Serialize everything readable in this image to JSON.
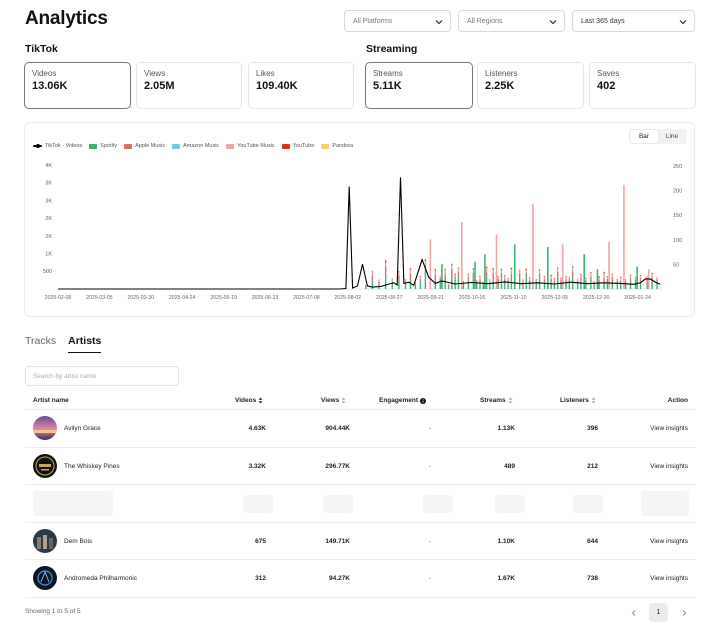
{
  "header": {
    "title": "Analytics"
  },
  "filters": {
    "platforms": "All Platforms",
    "regions": "All Regions",
    "period": "Last 365 days"
  },
  "tiktok": {
    "title": "TikTok",
    "stats": [
      {
        "label": "Videos",
        "value": "13.06K"
      },
      {
        "label": "Views",
        "value": "2.05M"
      },
      {
        "label": "Likes",
        "value": "109.40K"
      }
    ]
  },
  "streaming": {
    "title": "Streaming",
    "stats": [
      {
        "label": "Streams",
        "value": "5.11K"
      },
      {
        "label": "Listeners",
        "value": "2.25K"
      },
      {
        "label": "Saves",
        "value": "402"
      }
    ]
  },
  "chart_toggle": {
    "bar": "Bar",
    "line": "Line",
    "selected": "Bar"
  },
  "chart_data": {
    "type": "bar",
    "legend": [
      {
        "name": "TikTok - Videos",
        "color": "#000000",
        "kind": "line"
      },
      {
        "name": "Spotify",
        "color": "#3cb371",
        "kind": "bar"
      },
      {
        "name": "Apple Music",
        "color": "#e06b6b",
        "kind": "bar"
      },
      {
        "name": "Amazon Music",
        "color": "#76c7df",
        "kind": "bar"
      },
      {
        "name": "YouTube Music",
        "color": "#f2a3a3",
        "kind": "bar"
      },
      {
        "name": "YouTube",
        "color": "#d93025",
        "kind": "bar"
      },
      {
        "name": "Pandora",
        "color": "#f2d36b",
        "kind": "bar"
      }
    ],
    "left_axis_ticks": [
      "4K",
      "3K",
      "3K",
      "2K",
      "2K",
      "1K",
      "500"
    ],
    "right_axis_ticks": [
      "250",
      "200",
      "150",
      "100",
      "50"
    ],
    "x_ticks": [
      "2025-02-08",
      "2025-03-05",
      "2025-03-30",
      "2025-04-24",
      "2025-05-19",
      "2025-06-13",
      "2025-07-08",
      "2025-08-02",
      "2025-08-27",
      "2025-09-21",
      "2025-10-16",
      "2025-11-10",
      "2025-12-05",
      "2025-12-30",
      "2026-01-24"
    ],
    "ylim_left": [
      0,
      4000
    ],
    "ylim_right": [
      0,
      250
    ],
    "tiktok_videos": [
      [
        0,
        0
      ],
      [
        170,
        0
      ],
      [
        174,
        15
      ],
      [
        176,
        3300
      ],
      [
        178,
        30
      ],
      [
        181,
        100
      ],
      [
        184,
        800
      ],
      [
        187,
        100
      ],
      [
        190,
        60
      ],
      [
        195,
        80
      ],
      [
        200,
        160
      ],
      [
        203,
        200
      ],
      [
        205,
        130
      ],
      [
        207,
        3600
      ],
      [
        209,
        180
      ],
      [
        212,
        220
      ],
      [
        215,
        120
      ],
      [
        220,
        950
      ],
      [
        224,
        380
      ],
      [
        228,
        180
      ],
      [
        232,
        260
      ],
      [
        240,
        160
      ],
      [
        250,
        210
      ],
      [
        260,
        170
      ],
      [
        270,
        230
      ],
      [
        280,
        170
      ],
      [
        290,
        200
      ],
      [
        300,
        160
      ],
      [
        310,
        220
      ],
      [
        320,
        170
      ],
      [
        330,
        200
      ],
      [
        340,
        180
      ],
      [
        348,
        150
      ],
      [
        352,
        200
      ],
      [
        355,
        330
      ],
      [
        358,
        320
      ],
      [
        361,
        220
      ],
      [
        364,
        150
      ]
    ],
    "streams": [
      [
        186,
        10
      ],
      [
        190,
        40
      ],
      [
        194,
        20
      ],
      [
        198,
        60
      ],
      [
        202,
        25
      ],
      [
        206,
        35
      ],
      [
        210,
        20
      ],
      [
        213,
        45
      ],
      [
        216,
        15
      ],
      [
        219,
        30
      ],
      [
        222,
        55
      ],
      [
        225,
        20
      ],
      [
        228,
        40
      ],
      [
        231,
        25
      ],
      [
        234,
        45
      ],
      [
        236,
        15
      ],
      [
        238,
        50
      ],
      [
        240,
        30
      ],
      [
        242,
        40
      ],
      [
        245,
        20
      ],
      [
        248,
        35
      ],
      [
        251,
        50
      ],
      [
        253,
        20
      ],
      [
        255,
        30
      ],
      [
        257,
        15
      ],
      [
        259,
        60
      ],
      [
        261,
        20
      ],
      [
        263,
        45
      ],
      [
        266,
        25
      ],
      [
        268,
        35
      ],
      [
        270,
        30
      ],
      [
        272,
        20
      ],
      [
        274,
        50
      ],
      [
        276,
        25
      ],
      [
        279,
        35
      ],
      [
        281,
        20
      ],
      [
        283,
        40
      ],
      [
        285,
        30
      ],
      [
        287,
        25
      ],
      [
        289,
        20
      ],
      [
        291,
        45
      ],
      [
        294,
        30
      ],
      [
        296,
        20
      ],
      [
        298,
        35
      ],
      [
        300,
        25
      ],
      [
        302,
        40
      ],
      [
        304,
        20
      ],
      [
        307,
        30
      ],
      [
        309,
        25
      ],
      [
        311,
        40
      ],
      [
        314,
        20
      ],
      [
        316,
        30
      ],
      [
        319,
        25
      ],
      [
        322,
        35
      ],
      [
        324,
        20
      ],
      [
        327,
        30
      ],
      [
        330,
        40
      ],
      [
        332,
        25
      ],
      [
        335,
        30
      ],
      [
        338,
        20
      ],
      [
        340,
        30
      ],
      [
        343,
        25
      ],
      [
        346,
        35
      ],
      [
        349,
        25
      ],
      [
        352,
        30
      ],
      [
        356,
        25
      ],
      [
        359,
        30
      ],
      [
        362,
        25
      ]
    ],
    "streams_spikes": [
      [
        225,
        100
      ],
      [
        232,
        50
      ],
      [
        244,
        135
      ],
      [
        252,
        55
      ],
      [
        258,
        70
      ],
      [
        265,
        110
      ],
      [
        276,
        90
      ],
      [
        287,
        172
      ],
      [
        296,
        85
      ],
      [
        305,
        90
      ],
      [
        318,
        70
      ],
      [
        326,
        40
      ],
      [
        333,
        95
      ],
      [
        342,
        210
      ],
      [
        350,
        45
      ],
      [
        357,
        40
      ]
    ]
  },
  "tabs": {
    "tracks": "Tracks",
    "artists": "Artists"
  },
  "search": {
    "placeholder": "Search by artist name"
  },
  "table": {
    "headers": {
      "artist": "Artist name",
      "videos": "Videos",
      "views": "Views",
      "engagement": "Engagement",
      "streams": "Streams",
      "listeners": "Listeners",
      "action": "Action"
    },
    "rows": [
      {
        "name": "Avilyn Grace",
        "videos": "4.63K",
        "views": "904.44K",
        "engagement": "-",
        "streams": "1.13K",
        "listeners": "396",
        "action": "View insights"
      },
      {
        "name": "The Whiskey Pines",
        "videos": "3.32K",
        "views": "296.77K",
        "engagement": "-",
        "streams": "489",
        "listeners": "212",
        "action": "View insights"
      },
      {
        "name": "Dem Bois",
        "videos": "675",
        "views": "149.71K",
        "engagement": "-",
        "streams": "1.10K",
        "listeners": "644",
        "action": "View insights"
      },
      {
        "name": "Andromeda Philharmonic",
        "videos": "312",
        "views": "94.27K",
        "engagement": "-",
        "streams": "1.67K",
        "listeners": "738",
        "action": "View insights"
      }
    ]
  },
  "footer": {
    "showing": "Showing 1 to 5 of 5",
    "page": "1"
  }
}
